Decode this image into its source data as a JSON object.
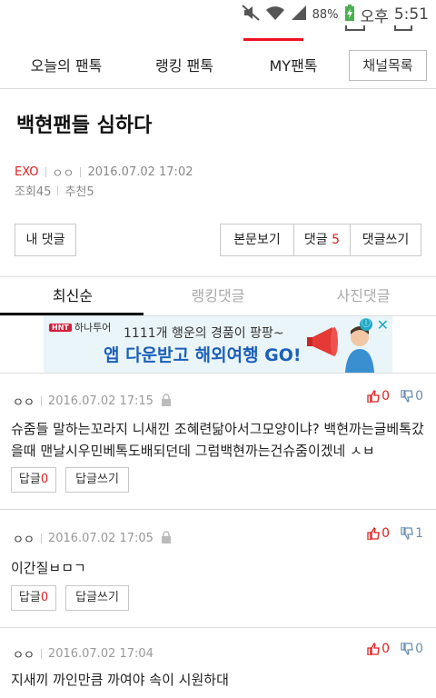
{
  "status_bar": {
    "battery_pct": "88%",
    "am_pm": "오후",
    "time": "5:51"
  },
  "top_tabs": [
    {
      "label": "오늘의 팬톡"
    },
    {
      "label": "랭킹 팬톡"
    },
    {
      "label": "MY팬톡"
    }
  ],
  "channel_list_label": "채널목록",
  "post": {
    "title": "백현팬들 심하다",
    "category": "EXO",
    "author": "ㅇㅇ",
    "datetime": "2016.07.02 17:02",
    "views_label": "조회45",
    "recommend_label": "추천5"
  },
  "buttons": {
    "my_comments": "내 댓글",
    "view_body": "본문보기",
    "comments_label": "댓글",
    "comments_count": "5",
    "write_comment": "댓글쓰기"
  },
  "comment_tabs": [
    {
      "label": "최신순",
      "active": true
    },
    {
      "label": "랭킹댓글",
      "active": false
    },
    {
      "label": "사진댓글",
      "active": false
    }
  ],
  "ad": {
    "brand": "하나투어",
    "brand_logo_text": "HNT",
    "line1": "1111개 행운의 경품이 팡팡~",
    "line2": "앱 다운받고 해외여행 GO!",
    "info_icon": "ⓘ",
    "close_icon": "✕"
  },
  "comments": [
    {
      "nick": "ㅇㅇ",
      "datetime": "2016.07.02 17:15",
      "up": "0",
      "down": "0",
      "body": "슈줌들 말하는꼬라지 니새낀 조혜련닮아서그모양이냐? 백현까는글베톡갔을때 맨날시우민베톡도배되던데 그럼백현까는건슈줌이겠네 ㅅㅂ",
      "reply_label": "답글",
      "reply_count": "0",
      "write_reply": "답글쓰기"
    },
    {
      "nick": "ㅇㅇ",
      "datetime": "2016.07.02 17:05",
      "up": "0",
      "down": "1",
      "body": "이간질ㅂㅁㄱ",
      "reply_label": "답글",
      "reply_count": "0",
      "write_reply": "답글쓰기"
    },
    {
      "nick": "ㅇㅇ",
      "datetime": "2016.07.02 17:04",
      "up": "0",
      "down": "0",
      "body": "지새끼 까인만큼 까여야 속이 시원하대"
    }
  ],
  "colors": {
    "accent_red": "#e02020",
    "ad_blue": "#1b5fb8",
    "ad_bg": "#eaf5f9"
  }
}
